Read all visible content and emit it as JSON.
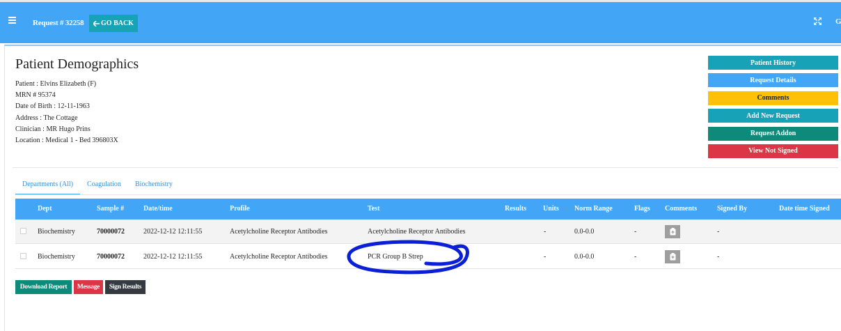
{
  "header": {
    "request_label": "Request # 32258",
    "go_back_label": "GO BACK",
    "user_initial": "G"
  },
  "demographics": {
    "title": "Patient Demographics",
    "lines": [
      "Patient : Elvins Elizabeth (F)",
      "MRN # 95374",
      "Date of Birth : 12-11-1963",
      "Address : The Cottage",
      "Clinician : MR Hugo Prins",
      "Location : Medical 1 - Bed 396803X"
    ]
  },
  "side_buttons": {
    "patient_history": "Patient History",
    "request_details": "Request Details",
    "comments": "Comments",
    "add_new_request": "Add New Request",
    "request_addon": "Request Addon",
    "view_not_signed": "View Not Signed"
  },
  "tabs": [
    "Departments (All)",
    "Coagulation",
    "Biochemistry"
  ],
  "table": {
    "headers": [
      "Dept",
      "Sample #",
      "Date/time",
      "Profile",
      "Test",
      "Results",
      "Units",
      "Norm Range",
      "Flags",
      "Comments",
      "Signed By",
      "Date time Signed"
    ],
    "rows": [
      {
        "dept": "Biochemistry",
        "sample": "70000072",
        "datetime": "2022-12-12 12:11:55",
        "profile": "Acetylcholine Receptor Antibodies",
        "test": "Acetylcholine Receptor Antibodies",
        "results": "",
        "units": "-",
        "norm_range": "0.0-0.0",
        "flags": "-",
        "signed_by": "-",
        "date_signed": ""
      },
      {
        "dept": "Biochemistry",
        "sample": "70000072",
        "datetime": "2022-12-12 12:11:55",
        "profile": "Acetylcholine Receptor Antibodies",
        "test": "PCR Group B Strep",
        "results": "",
        "units": "-",
        "norm_range": "0.0-0.0",
        "flags": "-",
        "signed_by": "-",
        "date_signed": ""
      }
    ]
  },
  "actions": {
    "download_report": "Download Report",
    "message": "Message",
    "sign_results": "Sign Results"
  },
  "colors": {
    "primary": "#42a5f5",
    "teal": "#17a2b8",
    "green": "#0d8a7a",
    "warning": "#ffc107",
    "danger": "#dc3545",
    "dark": "#343a40",
    "annotation": "#0a1fd6"
  }
}
